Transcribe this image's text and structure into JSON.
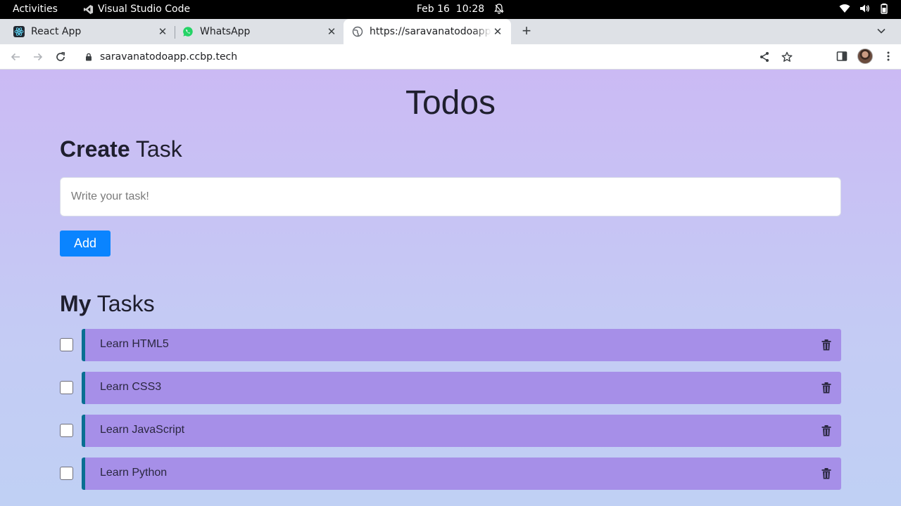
{
  "os_bar": {
    "activities": "Activities",
    "app_name": "Visual Studio Code",
    "date": "Feb 16",
    "time": "10:28"
  },
  "browser": {
    "tabs": [
      {
        "title": "React App",
        "icon": "react-icon",
        "active": false
      },
      {
        "title": "WhatsApp",
        "icon": "whatsapp-icon",
        "active": false
      },
      {
        "title": "https://saravanatodoapp.ccbp.tech",
        "icon": "globe-icon",
        "active": true
      }
    ],
    "url": "saravanatodoapp.ccbp.tech"
  },
  "app": {
    "title": "Todos",
    "create_heading_bold": "Create",
    "create_heading_rest": "Task",
    "input_placeholder": "Write your task!",
    "add_label": "Add",
    "tasks_heading_bold": "My",
    "tasks_heading_rest": "Tasks",
    "todos": [
      {
        "label": "Learn HTML5",
        "checked": false
      },
      {
        "label": "Learn CSS3",
        "checked": false
      },
      {
        "label": "Learn JavaScript",
        "checked": false
      },
      {
        "label": "Learn Python",
        "checked": false
      }
    ]
  },
  "colors": {
    "add_button": "#0a84ff",
    "todo_bar": "#a68fe8",
    "todo_accent": "#096f92",
    "page_gradient_top": "#cbbaf4",
    "page_gradient_bottom": "#c0d0f4"
  }
}
